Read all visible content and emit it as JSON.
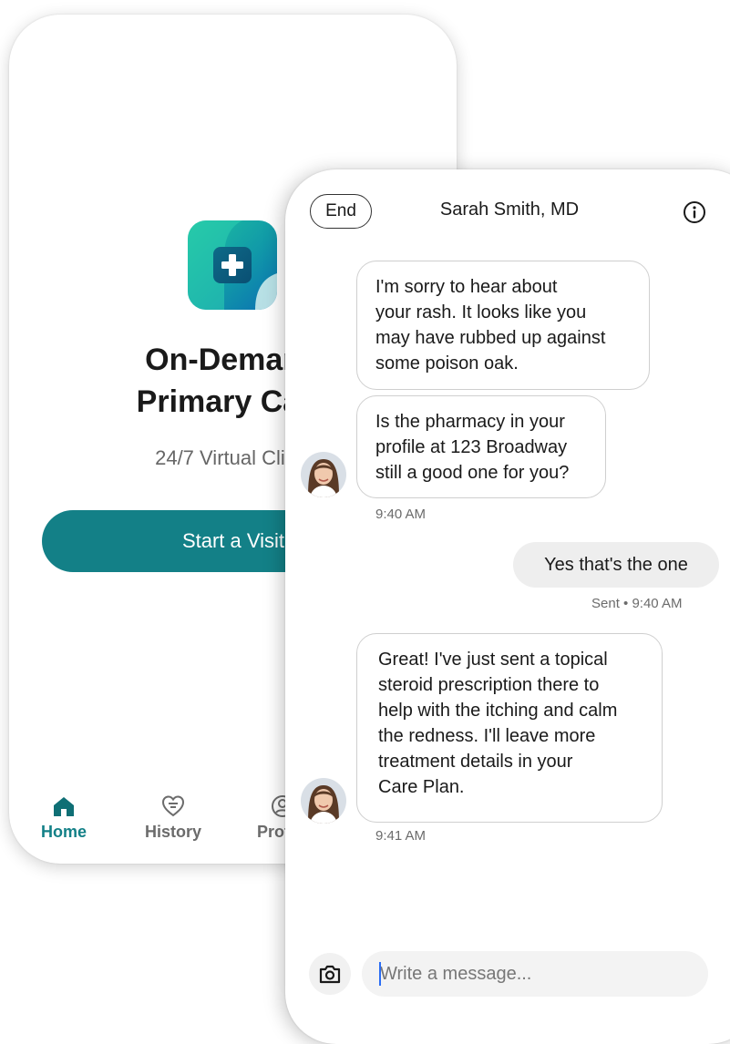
{
  "home": {
    "title_line1": "On-Demand",
    "title_line2": "Primary Care",
    "subtitle": "24/7 Virtual Clinic",
    "start_button": "Start a Visit",
    "nav": {
      "home": "Home",
      "history": "History",
      "profile": "Profile"
    }
  },
  "chat": {
    "end_button": "End",
    "title": "Sarah Smith, MD",
    "messages": [
      {
        "from": "doctor",
        "lines": [
          "I'm sorry to hear about",
          "your rash. It looks like you",
          "may have rubbed up against",
          "some poison oak."
        ]
      },
      {
        "from": "doctor",
        "lines": [
          "Is the pharmacy in your",
          "profile at 123 Broadway",
          "still a good one for you?"
        ],
        "time": "9:40 AM"
      },
      {
        "from": "user",
        "text": "Yes that's the one",
        "status": "Sent • 9:40 AM"
      },
      {
        "from": "doctor",
        "lines": [
          "Great! I've just sent a topical",
          "steroid prescription there to",
          "help with the itching and calm",
          "the redness. I'll leave more",
          "treatment details in your",
          "Care Plan."
        ],
        "time": "9:41 AM"
      }
    ],
    "input_placeholder": "Write a message..."
  },
  "colors": {
    "brand_teal": "#138087",
    "bubble_border": "#cfcfcf",
    "user_bubble": "#eeeeee",
    "muted_text": "#6b6b6b"
  },
  "icons": {
    "home": "home-icon",
    "history": "heart-list-icon",
    "profile": "user-circle-icon",
    "info": "info-icon",
    "camera": "camera-icon",
    "logo": "medical-cross-icon"
  }
}
